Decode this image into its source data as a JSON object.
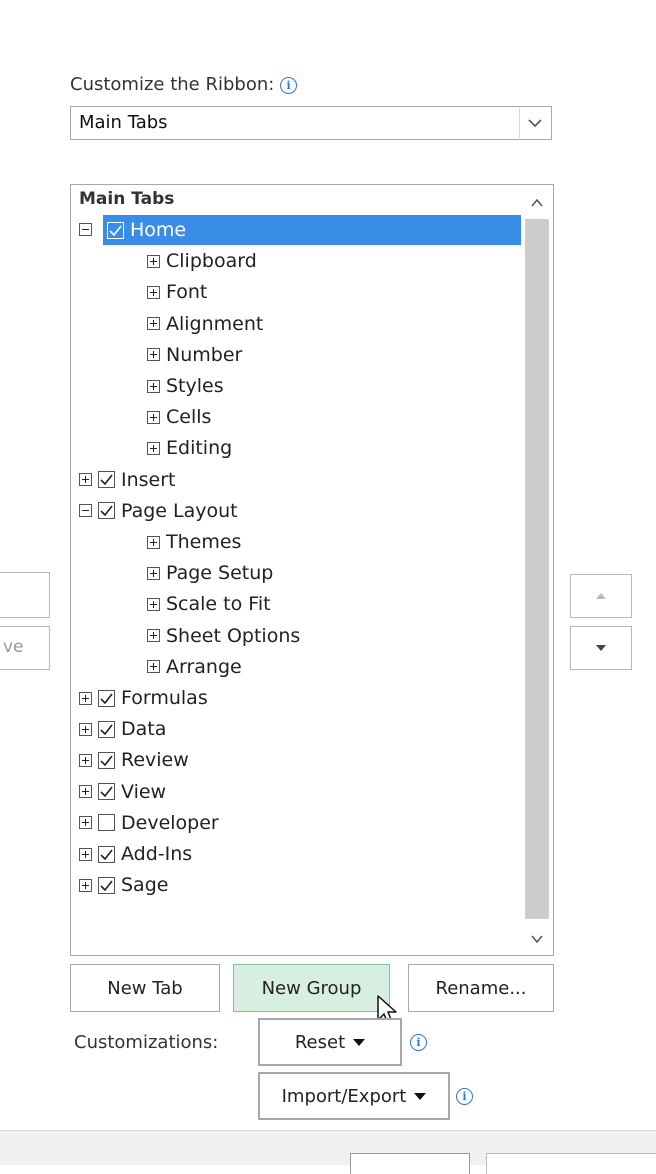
{
  "customize": {
    "label": "Customize the Ribbon:",
    "info_icon": "info-icon",
    "dropdown_value": "Main Tabs",
    "dropdown_icon": "chevron-down-icon"
  },
  "tree": {
    "header": "Main Tabs",
    "rows": [
      {
        "label": "Home",
        "level": 0,
        "expander": "minus",
        "checked": true,
        "selected": true
      },
      {
        "label": "Clipboard",
        "level": 1,
        "expander": "plus"
      },
      {
        "label": "Font",
        "level": 1,
        "expander": "plus"
      },
      {
        "label": "Alignment",
        "level": 1,
        "expander": "plus"
      },
      {
        "label": "Number",
        "level": 1,
        "expander": "plus"
      },
      {
        "label": "Styles",
        "level": 1,
        "expander": "plus"
      },
      {
        "label": "Cells",
        "level": 1,
        "expander": "plus"
      },
      {
        "label": "Editing",
        "level": 1,
        "expander": "plus"
      },
      {
        "label": "Insert",
        "level": 0,
        "expander": "plus",
        "checked": true
      },
      {
        "label": "Page Layout",
        "level": 0,
        "expander": "minus",
        "checked": true
      },
      {
        "label": "Themes",
        "level": 1,
        "expander": "plus"
      },
      {
        "label": "Page Setup",
        "level": 1,
        "expander": "plus"
      },
      {
        "label": "Scale to Fit",
        "level": 1,
        "expander": "plus"
      },
      {
        "label": "Sheet Options",
        "level": 1,
        "expander": "plus"
      },
      {
        "label": "Arrange",
        "level": 1,
        "expander": "plus"
      },
      {
        "label": "Formulas",
        "level": 0,
        "expander": "plus",
        "checked": true
      },
      {
        "label": "Data",
        "level": 0,
        "expander": "plus",
        "checked": true
      },
      {
        "label": "Review",
        "level": 0,
        "expander": "plus",
        "checked": true
      },
      {
        "label": "View",
        "level": 0,
        "expander": "plus",
        "checked": true
      },
      {
        "label": "Developer",
        "level": 0,
        "expander": "plus",
        "checked": false
      },
      {
        "label": "Add-Ins",
        "level": 0,
        "expander": "plus",
        "checked": true
      },
      {
        "label": "Sage",
        "level": 0,
        "expander": "plus",
        "checked": true
      }
    ]
  },
  "buttons": {
    "new_tab": "New Tab",
    "new_group": "New Group",
    "rename": "Rename...",
    "reset": "Reset",
    "import_export": "Import/Export"
  },
  "customizations_label": "Customizations:",
  "left_partial_text": "ve",
  "colors": {
    "selection": "#3a8de6",
    "active_button": "#d7efe1",
    "info": "#2b79d6"
  }
}
